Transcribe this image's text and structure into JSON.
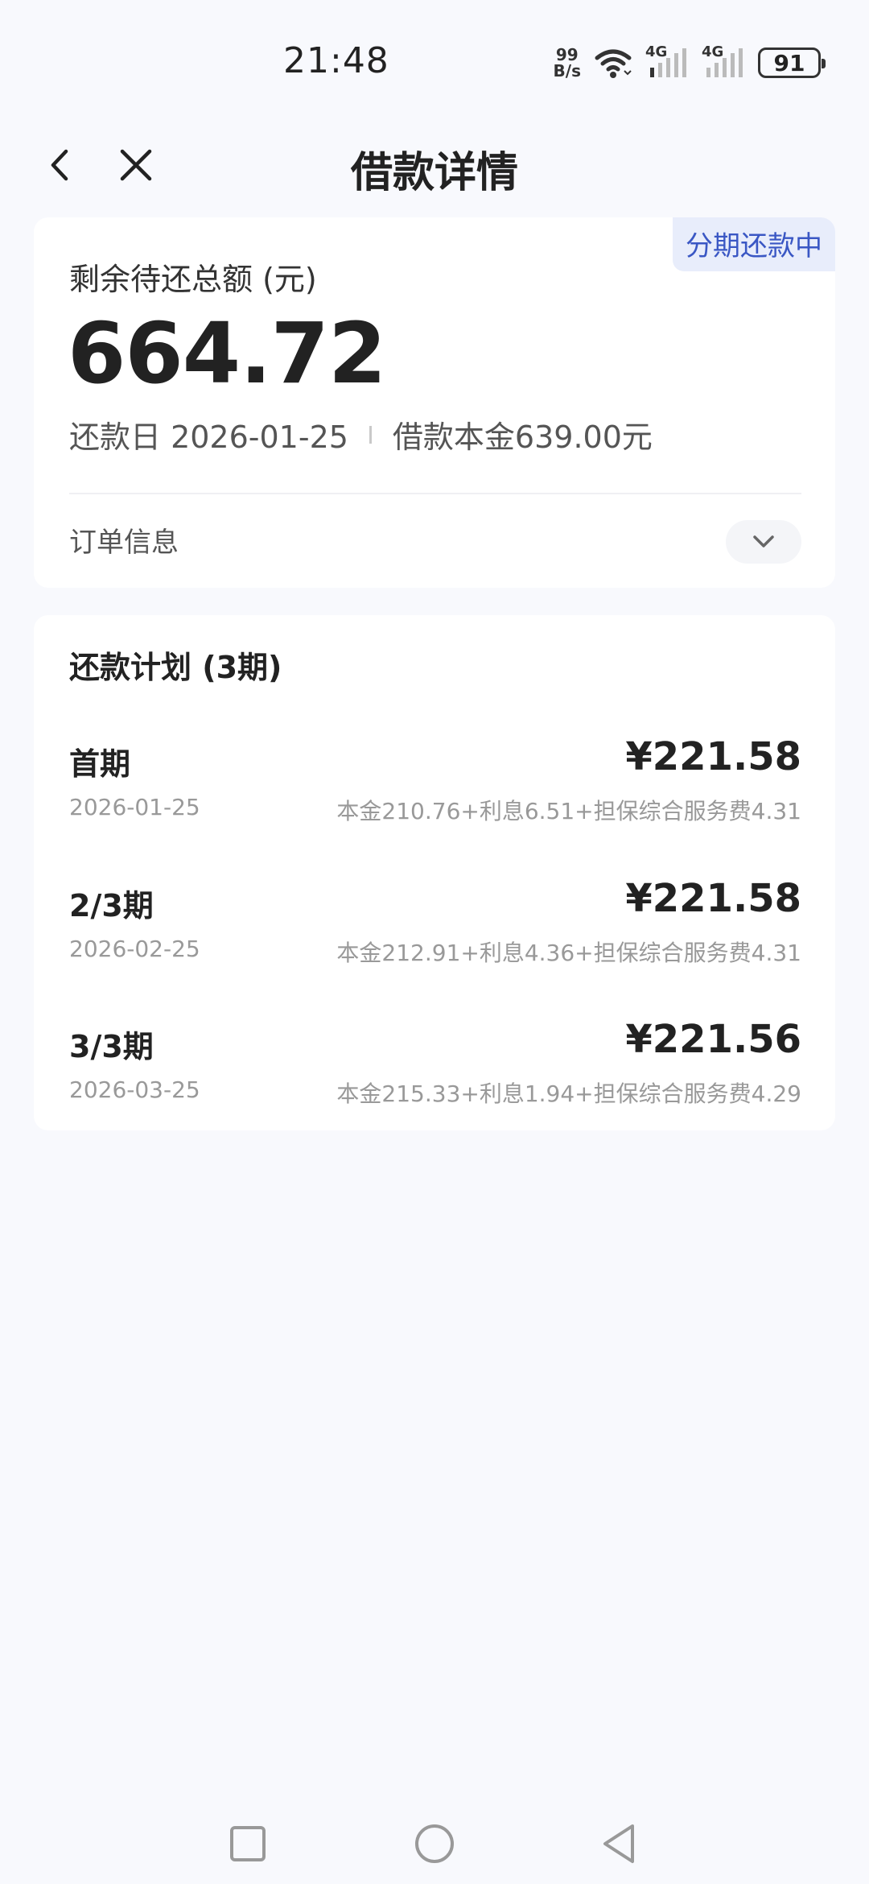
{
  "status_bar": {
    "time": "21:48",
    "net_speed_value": "99",
    "net_speed_unit": "B/s",
    "signal_label_1": "4G",
    "signal_label_2": "4G",
    "battery": "91"
  },
  "header": {
    "title": "借款详情"
  },
  "summary": {
    "status_badge": "分期还款中",
    "remaining_label": "剩余待还总额 (元)",
    "remaining_amount": "664.72",
    "due_date_text": "还款日 2026-01-25",
    "principal_text": "借款本金639.00元",
    "order_info_label": "订单信息"
  },
  "plan": {
    "title": "还款计划 (3期)",
    "rows": [
      {
        "term": "首期",
        "amount": "¥221.58",
        "date": "2026-01-25",
        "breakdown": "本金210.76+利息6.51+担保综合服务费4.31"
      },
      {
        "term": "2/3期",
        "amount": "¥221.58",
        "date": "2026-02-25",
        "breakdown": "本金212.91+利息4.36+担保综合服务费4.31"
      },
      {
        "term": "3/3期",
        "amount": "¥221.56",
        "date": "2026-03-25",
        "breakdown": "本金215.33+利息1.94+担保综合服务费4.29"
      }
    ]
  },
  "colors": {
    "background": "#f8f9fd",
    "badge_bg": "#e8edfb",
    "badge_text": "#3a57c4"
  },
  "icons": {
    "back": "chevron-left-icon",
    "close": "close-icon",
    "expand": "chevron-down-icon",
    "nav_recents": "square-icon",
    "nav_home": "circle-icon",
    "nav_back": "triangle-back-icon"
  }
}
